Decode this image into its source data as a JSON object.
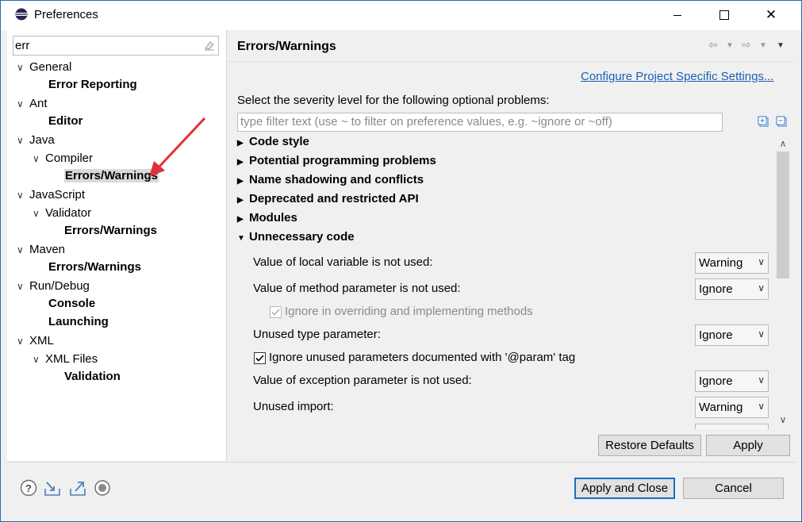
{
  "window": {
    "title": "Preferences"
  },
  "titlebar_buttons": {
    "minimize": "—",
    "maximize": "☐",
    "close": "✕"
  },
  "left": {
    "filter_value": "err",
    "tree": [
      {
        "label": "General",
        "level": 0,
        "expanded": true,
        "bold": false
      },
      {
        "label": "Error Reporting",
        "level": 1,
        "leaf": true,
        "bold": true
      },
      {
        "label": "Ant",
        "level": 0,
        "expanded": true,
        "bold": false
      },
      {
        "label": "Editor",
        "level": 1,
        "leaf": true,
        "bold": true
      },
      {
        "label": "Java",
        "level": 0,
        "expanded": true,
        "bold": false
      },
      {
        "label": "Compiler",
        "level": 1,
        "expanded": true,
        "bold": false
      },
      {
        "label": "Errors/Warnings",
        "level": 2,
        "leaf": true,
        "bold": true,
        "selected": true
      },
      {
        "label": "JavaScript",
        "level": 0,
        "expanded": true,
        "bold": false
      },
      {
        "label": "Validator",
        "level": 1,
        "expanded": true,
        "bold": false
      },
      {
        "label": "Errors/Warnings",
        "level": 2,
        "leaf": true,
        "bold": true
      },
      {
        "label": "Maven",
        "level": 0,
        "expanded": true,
        "bold": false
      },
      {
        "label": "Errors/Warnings",
        "level": 1,
        "leaf": true,
        "bold": true
      },
      {
        "label": "Run/Debug",
        "level": 0,
        "expanded": true,
        "bold": false
      },
      {
        "label": "Console",
        "level": 1,
        "leaf": true,
        "bold": true
      },
      {
        "label": "Launching",
        "level": 1,
        "leaf": true,
        "bold": true
      },
      {
        "label": "XML",
        "level": 0,
        "expanded": true,
        "bold": false
      },
      {
        "label": "XML Files",
        "level": 1,
        "expanded": true,
        "bold": false
      },
      {
        "label": "Validation",
        "level": 2,
        "leaf": true,
        "bold": true
      }
    ]
  },
  "right": {
    "page_title": "Errors/Warnings",
    "configure_link": "Configure Project Specific Settings...",
    "severity_text": "Select the severity level for the following optional problems:",
    "filter_placeholder": "type filter text (use ~ to filter on preference values, e.g. ~ignore or ~off)",
    "sections": [
      {
        "label": "Code style",
        "expanded": false
      },
      {
        "label": "Potential programming problems",
        "expanded": false
      },
      {
        "label": "Name shadowing and conflicts",
        "expanded": false
      },
      {
        "label": "Deprecated and restricted API",
        "expanded": false
      },
      {
        "label": "Modules",
        "expanded": false
      },
      {
        "label": "Unnecessary code",
        "expanded": true
      }
    ],
    "options": {
      "local_variable": {
        "label": "Value of local variable is not used:",
        "value": "Warning"
      },
      "method_parameter": {
        "label": "Value of method parameter is not used:",
        "value": "Ignore"
      },
      "ignore_overriding": {
        "label": "Ignore in overriding and implementing methods",
        "checked": true,
        "disabled": true
      },
      "unused_type_param": {
        "label": "Unused type parameter:",
        "value": "Ignore"
      },
      "ignore_param_tag": {
        "label": "Ignore unused parameters documented with '@param' tag",
        "checked": true,
        "disabled": false
      },
      "exception_param": {
        "label": "Value of exception parameter is not used:",
        "value": "Ignore"
      },
      "unused_import": {
        "label": "Unused import:",
        "value": "Warning"
      }
    },
    "restore_defaults": "Restore Defaults",
    "apply": "Apply"
  },
  "footer": {
    "apply_and_close": "Apply and Close",
    "cancel": "Cancel"
  },
  "colors": {
    "link": "#1a5fb4",
    "annotation_arrow": "#e0303a",
    "default_button_border": "#1a6fc4"
  }
}
